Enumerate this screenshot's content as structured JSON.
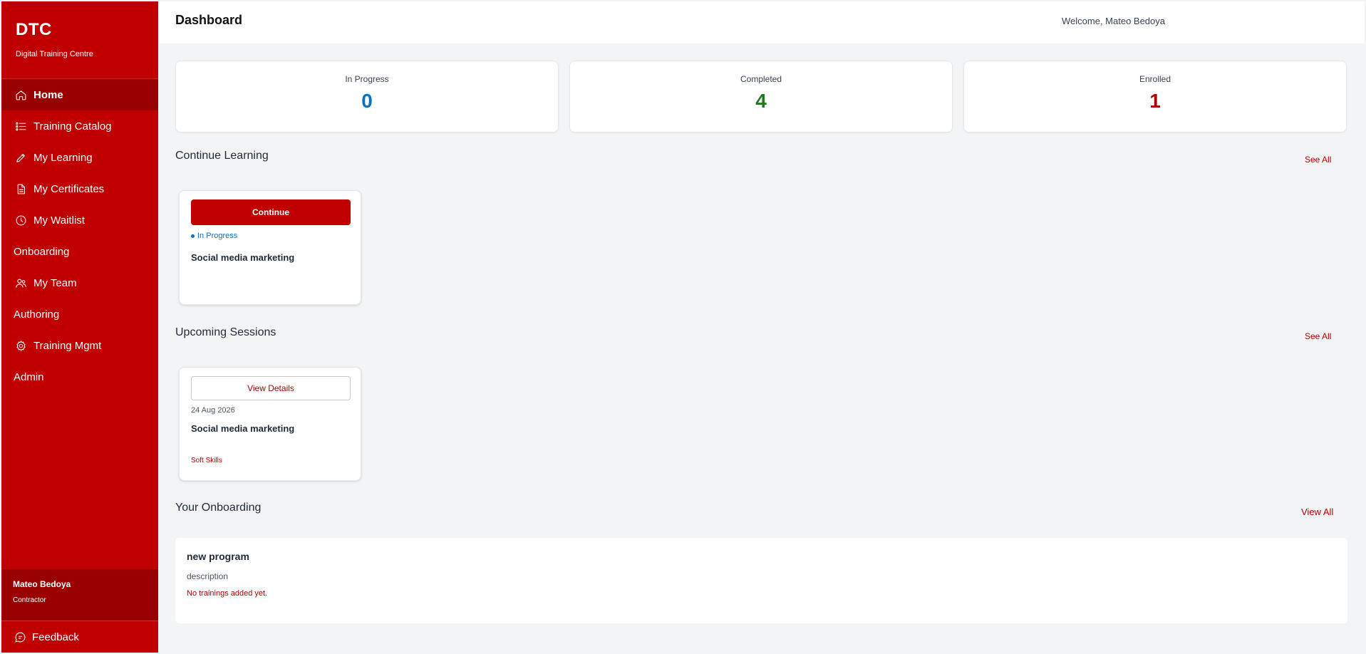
{
  "brand": {
    "title": "DTC",
    "subtitle": "Digital Training Centre"
  },
  "sidebar": {
    "items": [
      {
        "label": "Home",
        "icon": "home-icon"
      },
      {
        "label": "Training Catalog",
        "icon": "list-icon"
      },
      {
        "label": "My Learning",
        "icon": "pencil-icon"
      },
      {
        "label": "My Certificates",
        "icon": "document-icon"
      },
      {
        "label": "My Waitlist",
        "icon": "clock-icon"
      },
      {
        "label": "Onboarding"
      },
      {
        "label": "My Team",
        "icon": "users-icon"
      },
      {
        "label": "Authoring"
      },
      {
        "label": "Training Mgmt",
        "icon": "gear-icon"
      },
      {
        "label": "Admin"
      }
    ],
    "user": {
      "name": "Mateo Bedoya",
      "role": "Contractor"
    },
    "feedback_label": "Feedback"
  },
  "header": {
    "title": "Dashboard",
    "welcome": "Welcome, Mateo Bedoya"
  },
  "stats": [
    {
      "label": "In Progress",
      "value": "0",
      "color": "#0b6fc2"
    },
    {
      "label": "Completed",
      "value": "4",
      "color": "#1f7a1f"
    },
    {
      "label": "Enrolled",
      "value": "1",
      "color": "#b00000"
    }
  ],
  "continue_learning": {
    "title": "Continue Learning",
    "see_all": "See All",
    "card": {
      "button": "Continue",
      "status": "In Progress",
      "title": "Social media marketing"
    }
  },
  "upcoming_sessions": {
    "title": "Upcoming Sessions",
    "see_all": "See All",
    "card": {
      "button": "View Details",
      "date": "24 Aug 2026",
      "title": "Social media marketing",
      "tag": "Soft Skills"
    }
  },
  "onboarding": {
    "title": "Your Onboarding",
    "view_all": "View All",
    "program": {
      "title": "new program",
      "description": "description",
      "empty": "No trainings added yet."
    }
  },
  "colors": {
    "brand": "#c00000",
    "brand_dark": "#990000"
  }
}
